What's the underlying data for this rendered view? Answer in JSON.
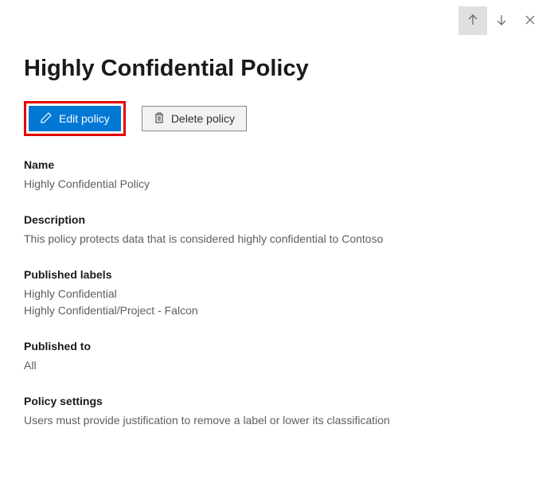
{
  "title": "Highly Confidential Policy",
  "buttons": {
    "edit": "Edit policy",
    "delete": "Delete policy"
  },
  "sections": {
    "name": {
      "label": "Name",
      "value": "Highly Confidential Policy"
    },
    "description": {
      "label": "Description",
      "value": "This policy protects data that is considered highly confidential to Contoso"
    },
    "publishedLabels": {
      "label": "Published labels",
      "value1": "Highly Confidential",
      "value2": "Highly Confidential/Project - Falcon"
    },
    "publishedTo": {
      "label": "Published to",
      "value": "All"
    },
    "policySettings": {
      "label": "Policy settings",
      "value": "Users must provide justification to remove a label or lower its classification"
    }
  }
}
